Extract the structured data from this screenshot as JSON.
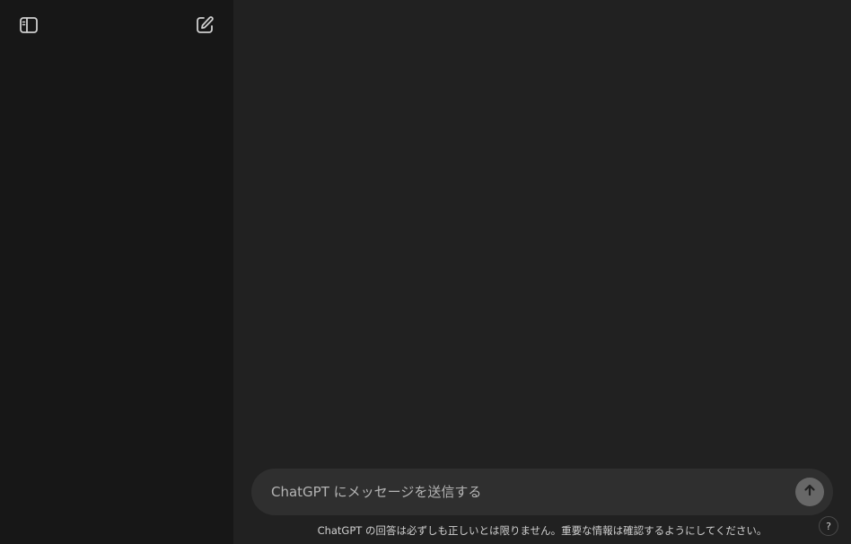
{
  "sidebar": {
    "toggle_icon": "sidebar-toggle-icon",
    "new_chat_icon": "new-chat-icon"
  },
  "composer": {
    "placeholder": "ChatGPT にメッセージを送信する",
    "value": "",
    "send_icon": "arrow-up-icon"
  },
  "footer": {
    "disclaimer": "ChatGPT の回答は必ずしも正しいとは限りません。重要な情報は確認するようにしてください。",
    "help_label": "?"
  },
  "colors": {
    "sidebar_bg": "#171717",
    "main_bg": "#212121",
    "composer_bg": "#2f2f2f",
    "send_button_bg": "#676767",
    "text": "#ececec"
  }
}
